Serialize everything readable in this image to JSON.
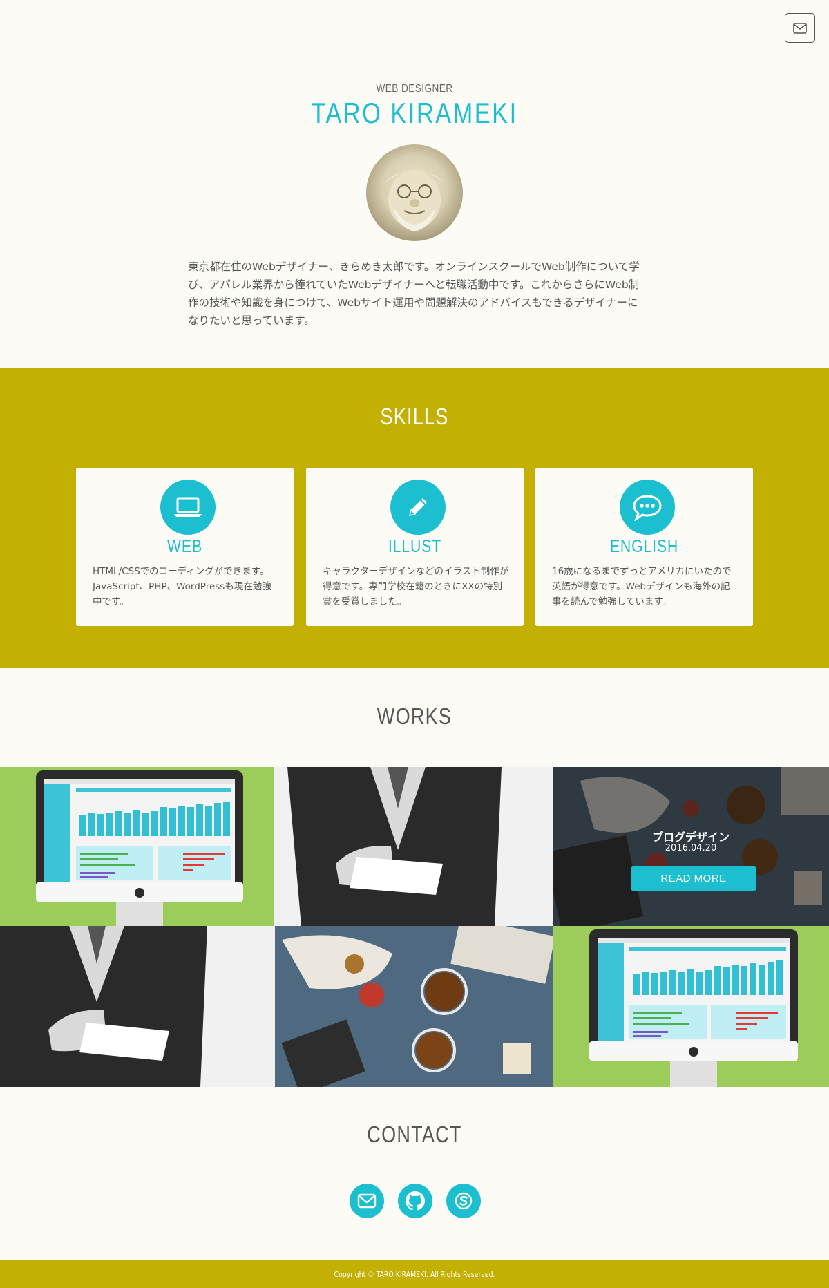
{
  "header": {
    "mail_icon": "mail-icon",
    "subtitle": "WEB DESIGNER",
    "name": "TARO KIRAMEKI"
  },
  "intro": {
    "text": "東京都在住のWebデザイナー、きらめき太郎です。オンラインスクールでWeb制作について学び、アパレル業界から憧れていたWebデザイナーへと転職活動中です。これからさらにWeb制作の技術や知識を身につけて、Webサイト運用や問題解決のアドバイスもできるデザイナーになりたいと思っています。"
  },
  "skills": {
    "title": "SKILLS",
    "items": [
      {
        "icon": "laptop-icon",
        "title": "WEB",
        "text": "HTML/CSSでのコーディングができます。JavaScript、PHP、WordPressも現在勉強中です。"
      },
      {
        "icon": "pencil-icon",
        "title": "ILLUST",
        "text": "キャラクターデザインなどのイラスト制作が得意です。専門学校在籍のときにXXの特別賞を受賞しました。"
      },
      {
        "icon": "speech-bubble-icon",
        "title": "ENGLISH",
        "text": "16歳になるまでずっとアメリカにいたので英語が得意です。Webデザインも海外の記事を読んで勉強しています。"
      }
    ]
  },
  "works": {
    "title": "WORKS",
    "hover": {
      "title": "ブログデザイン",
      "date": "2016.04.20",
      "button": "READ MORE"
    }
  },
  "contact": {
    "title": "CONTACT",
    "links": [
      "mail-icon",
      "github-icon",
      "skype-icon"
    ]
  },
  "footer": {
    "copyright": "Copyright © TARO KIRAMEKI. All Rights Reserved."
  },
  "colors": {
    "accent": "#1bbfd0",
    "band": "#c4b002",
    "background": "#fcfbf6",
    "tile_green": "#9ccc5a"
  }
}
